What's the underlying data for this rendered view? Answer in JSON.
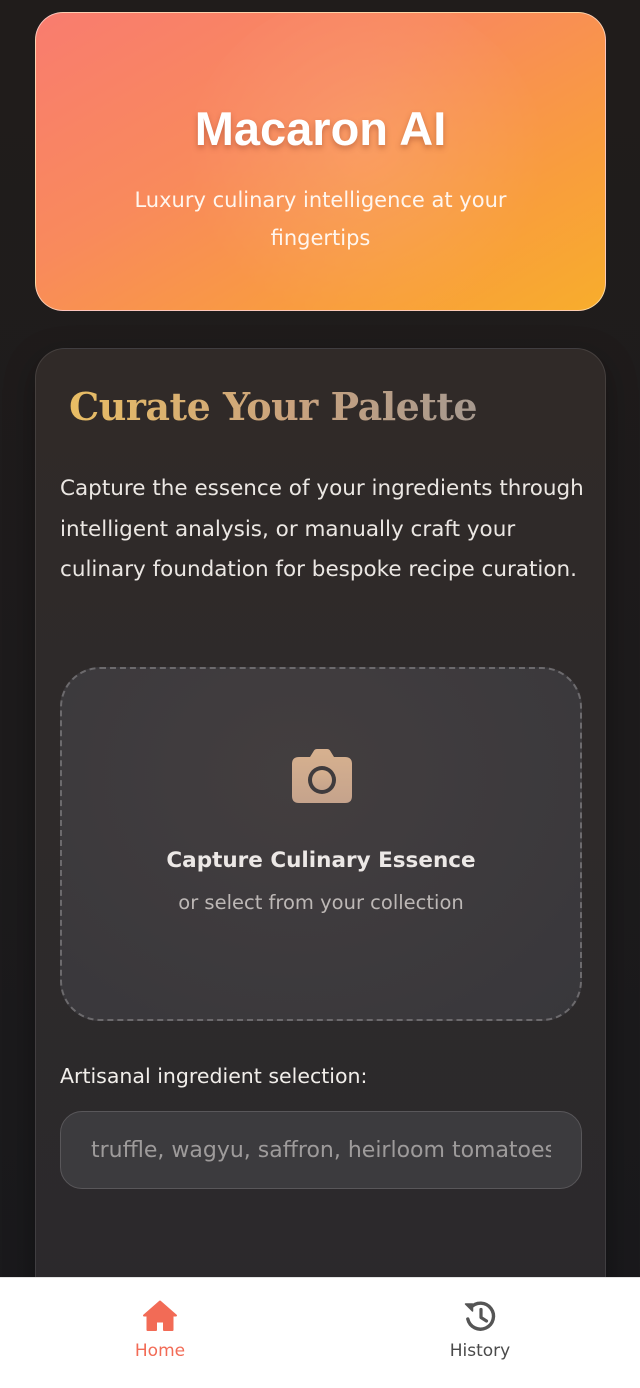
{
  "hero": {
    "title": "Macaron AI",
    "subtitle": "Luxury culinary intelligence at your fingertips"
  },
  "palette": {
    "title": "Curate Your Palette",
    "description": "Capture the essence of your ingredients through intelligent analysis, or manually craft your culinary foundation for bespoke recipe curation.",
    "upload": {
      "icon": "camera-icon",
      "title": "Capture Culinary Essence",
      "subtitle": "or select from your collection"
    },
    "ingredients": {
      "label": "Artisanal ingredient selection:",
      "value": "",
      "placeholder": "truffle, wagyu, saffron, heirloom tomatoes"
    }
  },
  "nav": {
    "items": [
      {
        "label": "Home",
        "icon": "home-icon",
        "active": true,
        "color": "#f26b56"
      },
      {
        "label": "History",
        "icon": "history-icon",
        "active": false,
        "color": "#4a4a4a"
      }
    ]
  },
  "colors": {
    "accent": "#f26b56",
    "hero_gradient_start": "#f97c6f",
    "hero_gradient_end": "#f8ad2c",
    "title_gold": "#e8bd64",
    "background": "#1d1b1c"
  }
}
